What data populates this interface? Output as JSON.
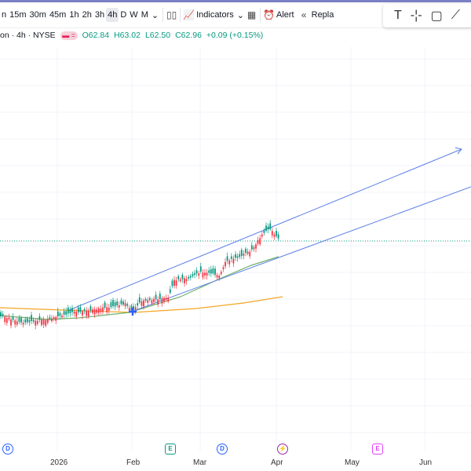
{
  "toolbar": {
    "intervals": [
      "15m",
      "30m",
      "45m",
      "1h",
      "2h",
      "3h",
      "4h",
      "D",
      "W",
      "M"
    ],
    "active_interval": "4h",
    "indicators_label": "Indicators",
    "alert_label": "Alert",
    "replay_label": "Repla"
  },
  "legend": {
    "symbol": "on · 4h · NYSE",
    "open": "O62.84",
    "high": "H63.02",
    "low": "L62.50",
    "close": "C62.96",
    "change": "+0.09 (+0.15%)"
  },
  "xaxis": {
    "labels": [
      "2026",
      "Feb",
      "Mar",
      "Apr",
      "May",
      "Jun"
    ]
  },
  "events": [
    {
      "type": "dividend",
      "glyph": "D",
      "color": "#2962ff"
    },
    {
      "type": "earnings",
      "glyph": "E",
      "color": "#089981"
    },
    {
      "type": "dividend",
      "glyph": "D",
      "color": "#2962ff"
    },
    {
      "type": "split",
      "glyph": "⚡",
      "color": "#9c27b0"
    },
    {
      "type": "earnings-upcoming",
      "glyph": "E",
      "color": "#e040fb"
    }
  ],
  "colors": {
    "up": "#089981",
    "down": "#f23645",
    "channel": "#5b7fe8",
    "ma_fast": "#6fb26b",
    "ma_slow": "#f5a623"
  }
}
